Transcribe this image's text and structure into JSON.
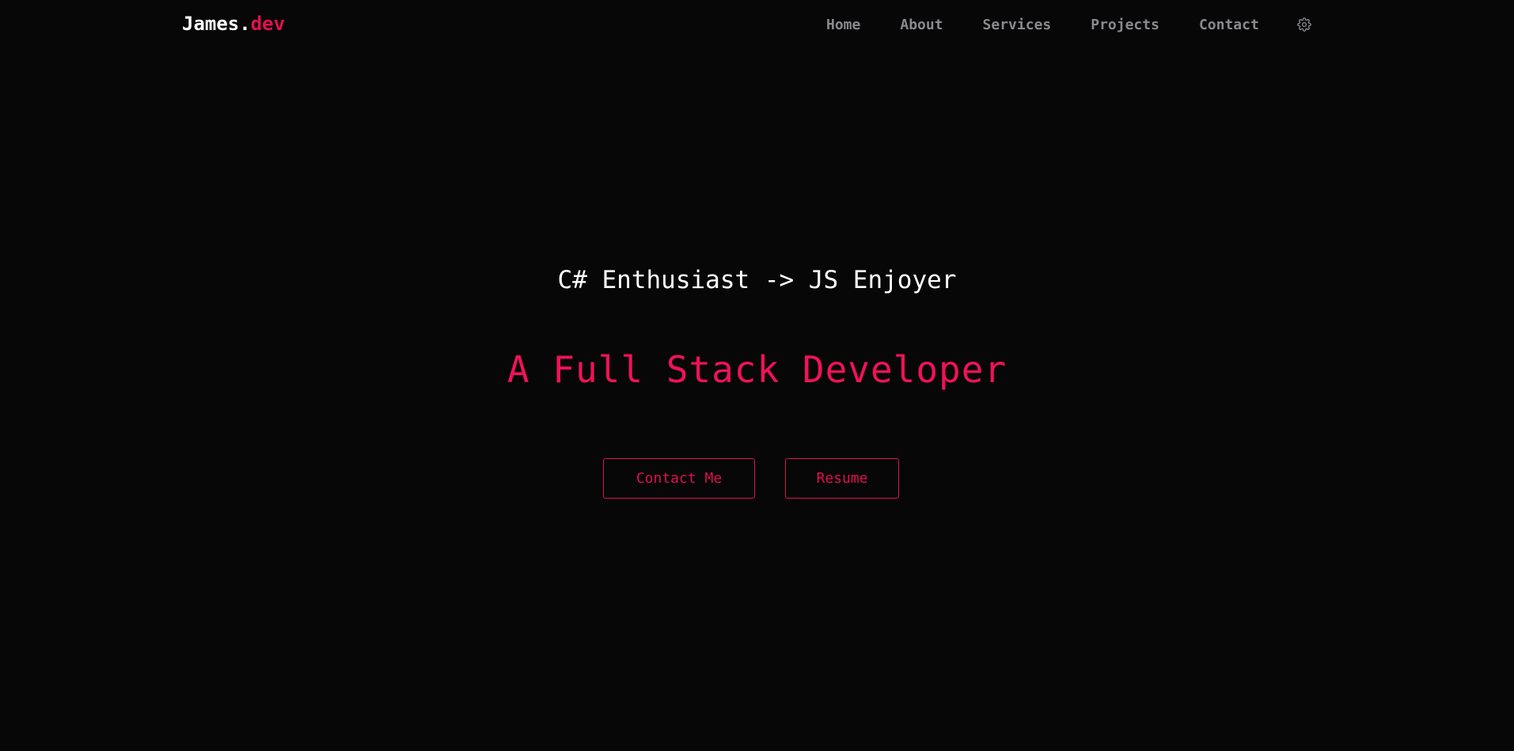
{
  "nav": {
    "brand_main": "James.",
    "brand_accent": "dev",
    "links": [
      {
        "label": "Home"
      },
      {
        "label": "About"
      },
      {
        "label": "Services"
      },
      {
        "label": "Projects"
      },
      {
        "label": "Contact"
      }
    ],
    "settings_icon": "gear-icon"
  },
  "hero": {
    "tagline": "C# Enthusiast -> JS Enjoyer",
    "title": "A Full Stack Developer",
    "buttons": {
      "contact_label": "Contact Me",
      "resume_label": "Resume"
    }
  },
  "colors": {
    "background": "#070708",
    "accent": "#e0104e",
    "nav_text": "#8a8a8e",
    "text": "#ffffff"
  }
}
